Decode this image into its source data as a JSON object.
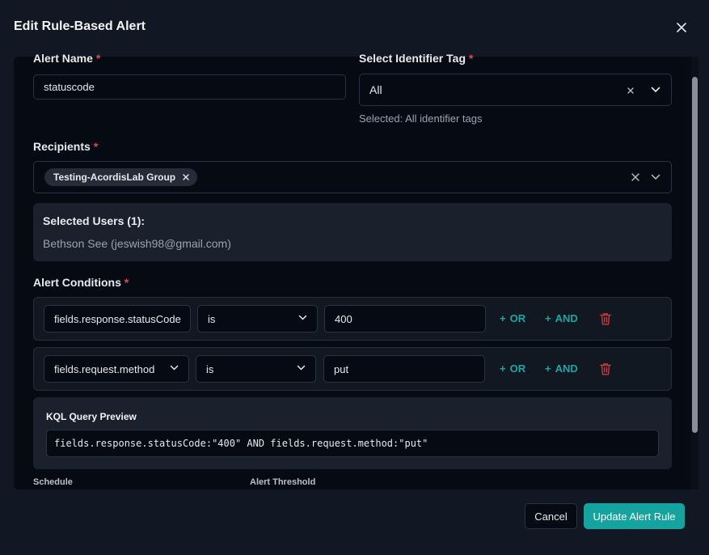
{
  "modal": {
    "title": "Edit Rule-Based Alert",
    "close_icon": "close-icon"
  },
  "form": {
    "alert_name": {
      "label": "Alert Name",
      "required_mark": "*",
      "value": "statuscode"
    },
    "identifier_tag": {
      "label": "Select Identifier Tag",
      "required_mark": "*",
      "value": "All",
      "helper": "Selected: All identifier tags"
    },
    "recipients": {
      "label": "Recipients",
      "required_mark": "*",
      "chips": [
        "Testing-AcordisLab Group"
      ]
    },
    "selected_users": {
      "title": "Selected Users (1):",
      "users": [
        "Bethson See (jeswish98@gmail.com)"
      ]
    },
    "conditions": {
      "label": "Alert Conditions",
      "required_mark": "*",
      "rows": [
        {
          "field": "fields.response.statusCode",
          "operator": "is",
          "value": "400",
          "or_label": "OR",
          "and_label": "AND"
        },
        {
          "field": "fields.request.method",
          "operator": "is",
          "value": "put",
          "or_label": "OR",
          "and_label": "AND"
        }
      ]
    },
    "kql": {
      "title": "KQL Query Preview",
      "query": "fields.response.statusCode:\"400\" AND fields.request.method:\"put\""
    },
    "schedule_label": "Schedule",
    "threshold_label": "Alert Threshold"
  },
  "footer": {
    "cancel_label": "Cancel",
    "submit_label": "Update Alert Rule"
  },
  "colors": {
    "accent": "#14a39e",
    "required": "#e5484d",
    "delete": "#c0393e",
    "background": "#111723",
    "panel": "#060a12"
  }
}
